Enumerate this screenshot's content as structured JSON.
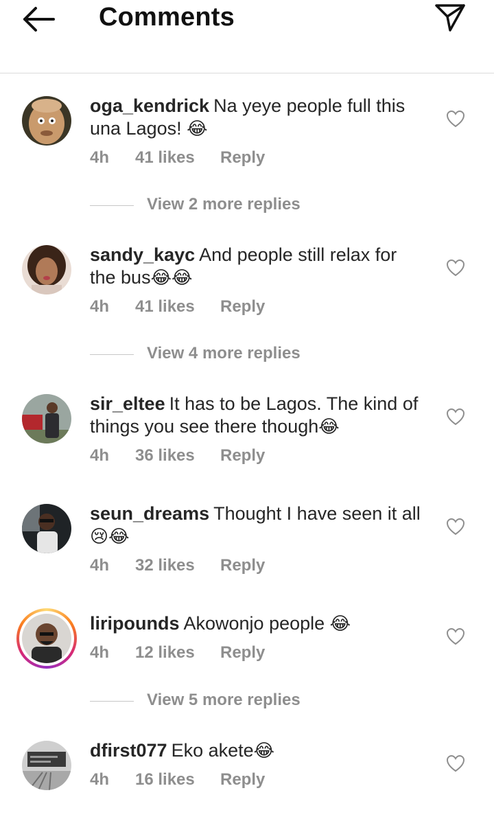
{
  "header": {
    "title": "Comments",
    "back_icon": "arrow-left-icon",
    "send_icon": "paper-plane-icon"
  },
  "comments": [
    {
      "username": "oga_kendrick",
      "text": "Na yeye people full this una Lagos!",
      "emoji": "😂",
      "time": "4h",
      "likes": "41 likes",
      "reply": "Reply",
      "view_replies": "View 2 more replies"
    },
    {
      "username": "sandy_kayc",
      "text": "And people still relax for the bus",
      "emoji": "😂😂",
      "time": "4h",
      "likes": "41 likes",
      "reply": "Reply",
      "view_replies": "View 4 more replies"
    },
    {
      "username": "sir_eltee",
      "text": "It has to be Lagos. The kind of things you see there though",
      "emoji": "😂",
      "time": "4h",
      "likes": "36 likes",
      "reply": "Reply"
    },
    {
      "username": "seun_dreams",
      "text": "Thought I have seen it all",
      "emoji": "😢😂",
      "time": "4h",
      "likes": "32 likes",
      "reply": "Reply"
    },
    {
      "username": "liripounds",
      "text": "Akowonjo people",
      "emoji": "😂",
      "time": "4h",
      "likes": "12 likes",
      "reply": "Reply",
      "view_replies": "View 5 more replies"
    },
    {
      "username": "dfirst077",
      "text": "Eko akete",
      "emoji": "😂",
      "time": "4h",
      "likes": "16 likes",
      "reply": "Reply"
    }
  ],
  "colors": {
    "text": "#262626",
    "meta": "#8e8e8e",
    "divider": "#dbdbdb"
  }
}
